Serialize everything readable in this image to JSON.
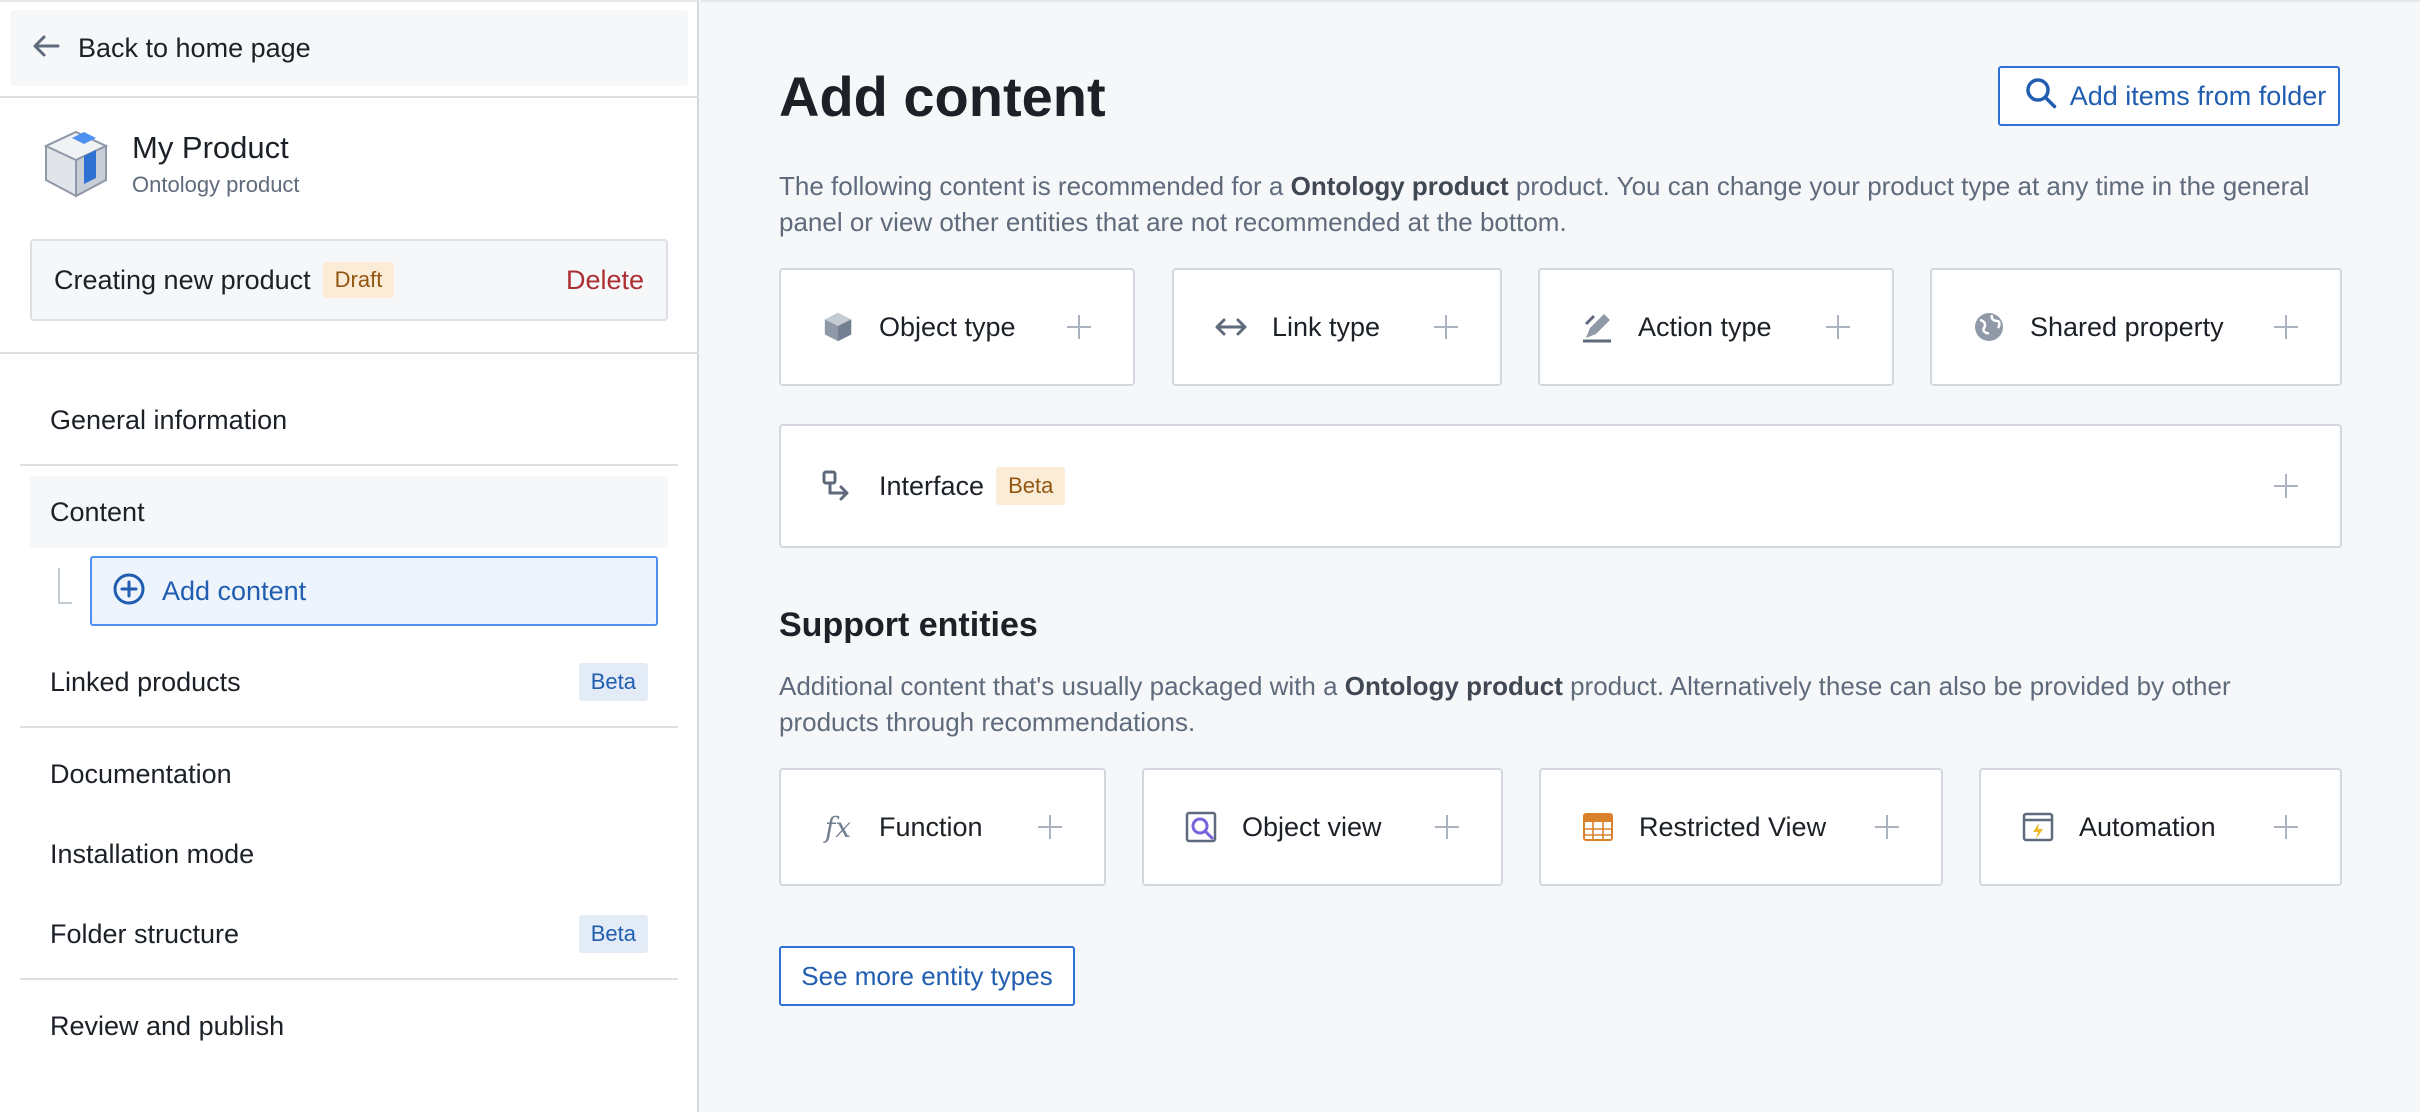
{
  "sidebar": {
    "back_label": "Back to home page",
    "product": {
      "name": "My Product",
      "subtitle": "Ontology product"
    },
    "status": {
      "label": "Creating new product",
      "tag": "Draft",
      "delete_label": "Delete"
    },
    "nav": {
      "general": "General information",
      "content": "Content",
      "add_content": "Add content",
      "linked_products": "Linked products",
      "linked_products_tag": "Beta",
      "documentation": "Documentation",
      "installation_mode": "Installation mode",
      "folder_structure": "Folder structure",
      "folder_structure_tag": "Beta",
      "review_publish": "Review and publish"
    }
  },
  "main": {
    "title": "Add content",
    "folder_button": "Add items from folder",
    "recommended_desc": {
      "pre": "The following content is recommended for a ",
      "bold": "Ontology product",
      "post": " product. You can change your product type at any time in the general panel or view other entities that are not recommended at the bottom."
    },
    "recommended_cards": {
      "object_type": "Object type",
      "link_type": "Link type",
      "action_type": "Action type",
      "shared_property": "Shared property",
      "interface": "Interface",
      "interface_tag": "Beta"
    },
    "support_title": "Support entities",
    "support_desc": {
      "pre": "Additional content that's usually packaged with a ",
      "bold": "Ontology product",
      "post": " product. Alternatively these can also be provided by other products through recommendations."
    },
    "support_cards": {
      "function": "Function",
      "object_view": "Object view",
      "restricted_view": "Restricted View",
      "automation": "Automation"
    },
    "more_button": "See more entity types"
  },
  "icons": {
    "back": "arrow-left-icon",
    "product": "cube-icon",
    "add": "add-circle-icon",
    "search": "search-icon",
    "object_type": "cube-icon",
    "link_type": "arrows-horizontal-icon",
    "action_type": "edit-icon",
    "shared_property": "globe-icon",
    "interface": "interface-icon",
    "function": "function-icon",
    "object_view": "object-view-icon",
    "restricted_view": "table-icon",
    "automation": "automation-icon"
  },
  "colors": {
    "accent": "#215db0",
    "danger": "#ac2f33",
    "warning_tag": "#935610",
    "beta_tag": "#215db0"
  }
}
